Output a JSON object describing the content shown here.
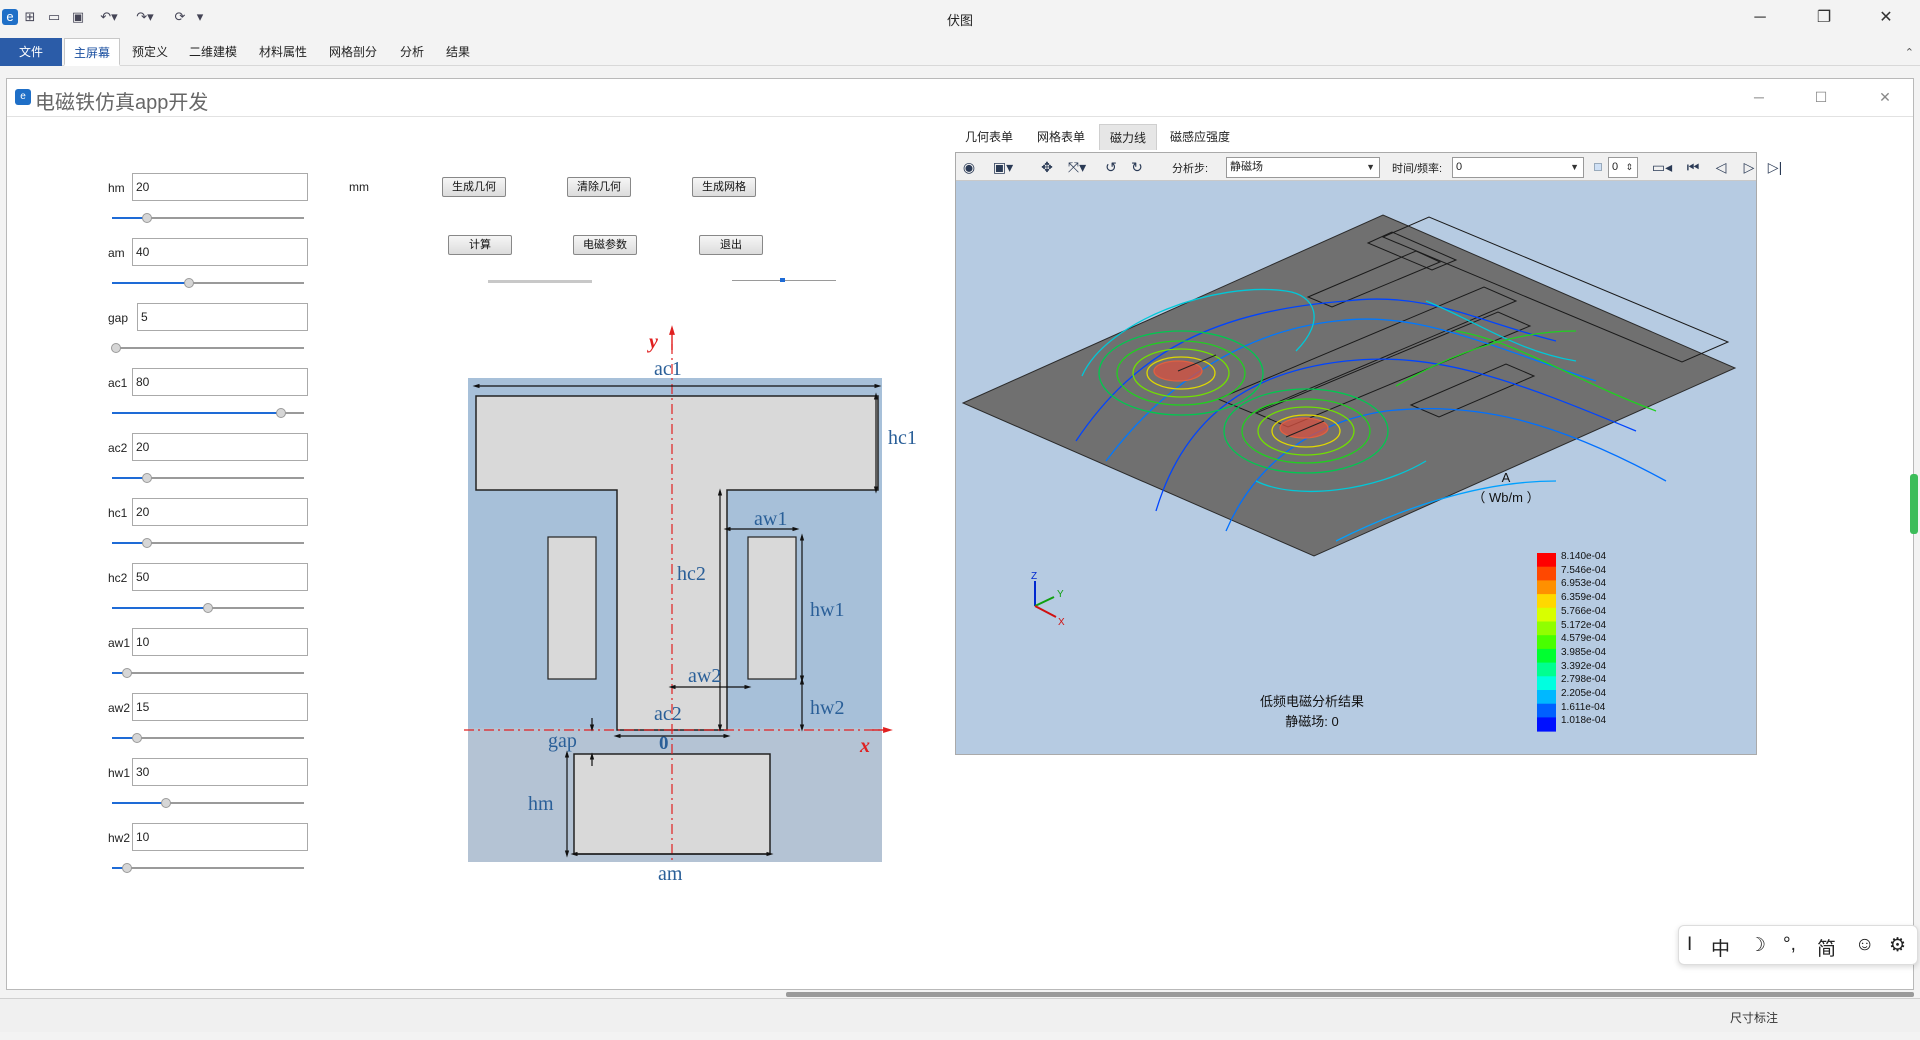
{
  "titlebar": {
    "title": "伏图",
    "icons": [
      "app-logo-icon",
      "new-file-icon",
      "open-folder-icon",
      "save-icon",
      "undo-icon",
      "redo-icon",
      "refresh-icon",
      "customize-icon"
    ],
    "minimize": "─",
    "restore": "❐",
    "close": "✕"
  },
  "ribbon": {
    "tabs": [
      "文件",
      "主屏幕",
      "预定义",
      "二维建模",
      "材料属性",
      "网格剖分",
      "分析",
      "结果"
    ],
    "active_tab": "主屏幕",
    "collapse": "⌃"
  },
  "app_window": {
    "title": "电磁铁仿真app开发",
    "icon_glyph": "e",
    "minimize": "─",
    "maximize": "☐",
    "close": "✕"
  },
  "params": [
    {
      "label": "hm",
      "value": "20",
      "level": 0.18
    },
    {
      "label": "am",
      "value": "40",
      "level": 0.4
    },
    {
      "label": "gap",
      "value": "5",
      "level": 0.02
    },
    {
      "label": "ac1",
      "value": "80",
      "level": 0.88
    },
    {
      "label": "ac2",
      "value": "20",
      "level": 0.18
    },
    {
      "label": "hc1",
      "value": "20",
      "level": 0.18
    },
    {
      "label": "hc2",
      "value": "50",
      "level": 0.5
    },
    {
      "label": "aw1",
      "value": "10",
      "level": 0.08
    },
    {
      "label": "aw2",
      "value": "15",
      "level": 0.13
    },
    {
      "label": "hw1",
      "value": "30",
      "level": 0.28
    },
    {
      "label": "hw2",
      "value": "10",
      "level": 0.08
    }
  ],
  "unit": "mm",
  "buttons": {
    "gen_geom": "生成几何",
    "clear_geom": "清除几何",
    "gen_mesh": "生成网格",
    "compute": "计算",
    "em_params": "电磁参数",
    "exit": "退出"
  },
  "drawing": {
    "labels": {
      "ac1": "ac1",
      "hc1": "hc1",
      "aw1": "aw1",
      "hc2": "hc2",
      "hw1": "hw1",
      "aw2": "aw2",
      "hw2": "hw2",
      "ac2": "ac2",
      "gap": "gap",
      "origin": "0",
      "hm": "hm",
      "am": "am",
      "x": "x",
      "y": "y"
    }
  },
  "viewer_tabs": [
    "几何表单",
    "网格表单",
    "磁力线",
    "磁感应强度"
  ],
  "viewer_active_tab": "磁力线",
  "toolbar": {
    "analysis_step_label": "分析步:",
    "analysis_step_value": "静磁场",
    "time_freq_label": "时间/频率:",
    "time_freq_value": "0",
    "frame_value": "0"
  },
  "legend": {
    "quantity": "A",
    "unit": "（ Wb/m ）",
    "values": [
      "8.140e-04",
      "7.546e-04",
      "6.953e-04",
      "6.359e-04",
      "5.766e-04",
      "5.172e-04",
      "4.579e-04",
      "3.985e-04",
      "3.392e-04",
      "2.798e-04",
      "2.205e-04",
      "1.611e-04",
      "1.018e-04"
    ],
    "colors": [
      "#ff0000",
      "#ff4800",
      "#ff9000",
      "#ffd800",
      "#d8ff00",
      "#90ff00",
      "#48ff00",
      "#00ff30",
      "#00ff90",
      "#00ffe0",
      "#00b8ff",
      "#0060ff",
      "#0010ff"
    ]
  },
  "result": {
    "line1": "低频电磁分析结果",
    "line2": "静磁场: 0"
  },
  "axes": {
    "z": "Z",
    "y": "Y",
    "x": "X"
  },
  "ime": [
    "I",
    "中",
    "☽",
    "°,",
    "简",
    "☺",
    "⚙"
  ],
  "status": {
    "right": "尺寸标注"
  }
}
